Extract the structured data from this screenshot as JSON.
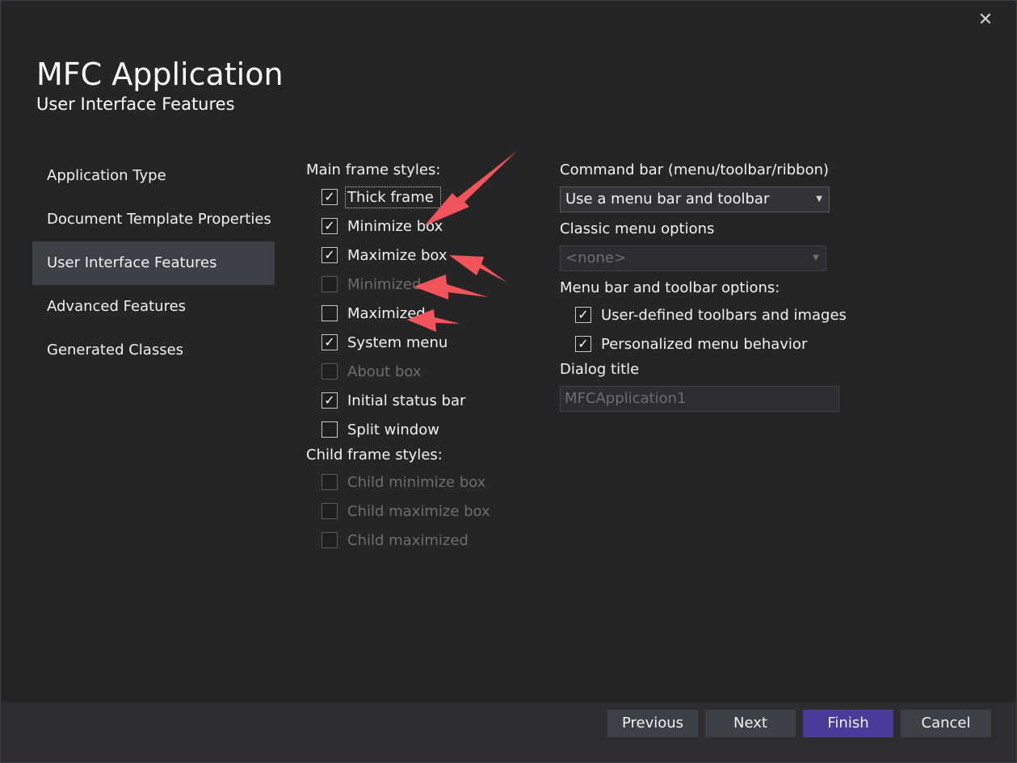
{
  "window": {
    "close_glyph": "✕"
  },
  "header": {
    "title": "MFC Application",
    "subtitle": "User Interface Features"
  },
  "sidebar": {
    "items": [
      {
        "label": "Application Type",
        "active": false
      },
      {
        "label": "Document Template Properties",
        "active": false
      },
      {
        "label": "User Interface Features",
        "active": true
      },
      {
        "label": "Advanced Features",
        "active": false
      },
      {
        "label": "Generated Classes",
        "active": false
      }
    ]
  },
  "main_frame": {
    "label": "Main frame styles:",
    "options": [
      {
        "label": "Thick frame",
        "checked": true,
        "disabled": false
      },
      {
        "label": "Minimize box",
        "checked": true,
        "disabled": false
      },
      {
        "label": "Maximize box",
        "checked": true,
        "disabled": false
      },
      {
        "label": "Minimized",
        "checked": false,
        "disabled": true
      },
      {
        "label": "Maximized",
        "checked": false,
        "disabled": false
      },
      {
        "label": "System menu",
        "checked": true,
        "disabled": false
      },
      {
        "label": "About box",
        "checked": false,
        "disabled": true
      },
      {
        "label": "Initial status bar",
        "checked": true,
        "disabled": false
      },
      {
        "label": "Split window",
        "checked": false,
        "disabled": false
      }
    ]
  },
  "child_frame": {
    "label": "Child frame styles:",
    "options": [
      {
        "label": "Child minimize box",
        "checked": false,
        "disabled": true
      },
      {
        "label": "Child maximize box",
        "checked": false,
        "disabled": true
      },
      {
        "label": "Child maximized",
        "checked": false,
        "disabled": true
      }
    ]
  },
  "command_bar": {
    "label": "Command bar (menu/toolbar/ribbon)",
    "value": "Use a menu bar and toolbar"
  },
  "classic_menu": {
    "label": "Classic menu options",
    "value": "<none>"
  },
  "menu_toolbar": {
    "label": "Menu bar and toolbar options:",
    "options": [
      {
        "label": "User-defined toolbars and images",
        "checked": true
      },
      {
        "label": "Personalized menu behavior",
        "checked": true
      }
    ]
  },
  "dialog_title": {
    "label": "Dialog title",
    "value": "MFCApplication1"
  },
  "footer": {
    "previous": "Previous",
    "next": "Next",
    "finish": "Finish",
    "cancel": "Cancel"
  },
  "annotation_color": "#f2545b",
  "check_glyph": "✓"
}
